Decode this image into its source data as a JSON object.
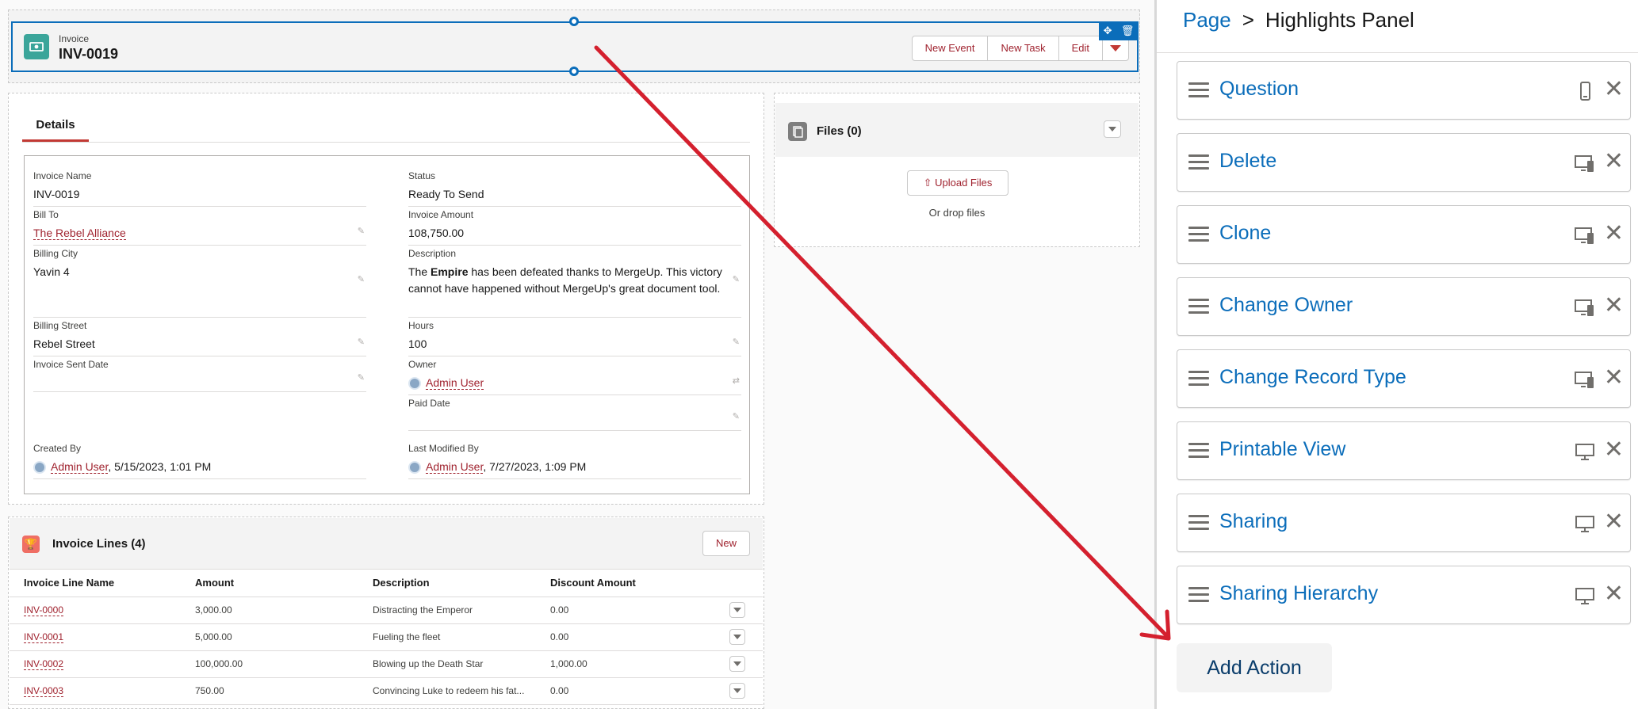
{
  "highlights": {
    "object_label": "Invoice",
    "record_name": "INV-0019",
    "actions": [
      "New Event",
      "New Task",
      "Edit"
    ]
  },
  "details": {
    "tab_label": "Details",
    "fields": {
      "invoice_name": {
        "label": "Invoice Name",
        "value": "INV-0019"
      },
      "status": {
        "label": "Status",
        "value": "Ready To Send"
      },
      "bill_to": {
        "label": "Bill To",
        "value": "The Rebel Alliance"
      },
      "invoice_amount": {
        "label": "Invoice Amount",
        "value": "108,750.00"
      },
      "billing_city": {
        "label": "Billing City",
        "value": "Yavin 4"
      },
      "description": {
        "label": "Description",
        "pre": "The ",
        "bold": "Empire",
        "post": " has been defeated thanks to MergeUp. This victory cannot have happened without MergeUp's great document tool."
      },
      "billing_street": {
        "label": "Billing Street",
        "value": "Rebel Street"
      },
      "hours": {
        "label": "Hours",
        "value": "100"
      },
      "invoice_sent_date": {
        "label": "Invoice Sent Date",
        "value": ""
      },
      "owner": {
        "label": "Owner",
        "value": "Admin User"
      },
      "paid_date": {
        "label": "Paid Date",
        "value": ""
      },
      "created_by": {
        "label": "Created By",
        "user": "Admin User",
        "date": ", 5/15/2023, 1:01 PM"
      },
      "last_modified_by": {
        "label": "Last Modified By",
        "user": "Admin User",
        "date": ", 7/27/2023, 1:09 PM"
      }
    }
  },
  "invoice_lines": {
    "title": "Invoice Lines (4)",
    "new_label": "New",
    "columns": [
      "Invoice Line Name",
      "Amount",
      "Description",
      "Discount Amount"
    ],
    "rows": [
      [
        "INV-0000",
        "3,000.00",
        "Distracting the Emperor",
        "0.00"
      ],
      [
        "INV-0001",
        "5,000.00",
        "Fueling the fleet",
        "0.00"
      ],
      [
        "INV-0002",
        "100,000.00",
        "Blowing up the Death Star",
        "1,000.00"
      ],
      [
        "INV-0003",
        "750.00",
        "Convincing Luke to redeem his fat...",
        "0.00"
      ]
    ]
  },
  "files": {
    "title": "Files (0)",
    "upload_label": "Upload Files",
    "drop_text": "Or drop files"
  },
  "panel": {
    "breadcrumb_root": "Page",
    "breadcrumb_sep": ">",
    "breadcrumb_current": "Highlights Panel",
    "actions": [
      {
        "label": "Question",
        "device": "phone"
      },
      {
        "label": "Delete",
        "device": "desktop-phone"
      },
      {
        "label": "Clone",
        "device": "desktop-phone"
      },
      {
        "label": "Change Owner",
        "device": "desktop-phone"
      },
      {
        "label": "Change Record Type",
        "device": "desktop-phone"
      },
      {
        "label": "Printable View",
        "device": "desktop"
      },
      {
        "label": "Sharing",
        "device": "desktop"
      },
      {
        "label": "Sharing Hierarchy",
        "device": "desktop"
      }
    ],
    "add_action_label": "Add Action"
  },
  "colors": {
    "accent_blue": "#0b6dba",
    "link_red": "#a0232f",
    "arrow_red": "#d4202e"
  }
}
